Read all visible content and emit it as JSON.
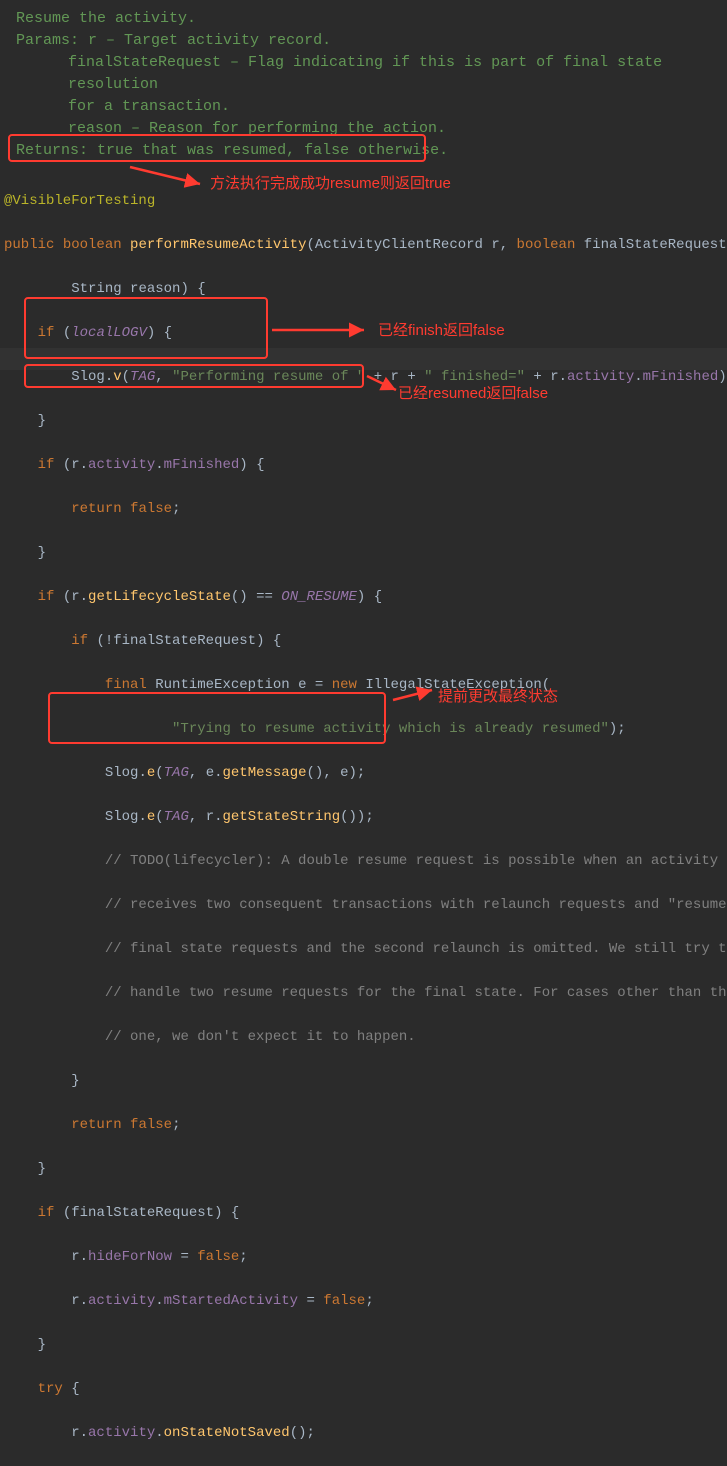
{
  "doc": {
    "l1": "Resume the activity.",
    "params_label": "Params:",
    "p1": "r – Target activity record.",
    "p2": "finalStateRequest – Flag indicating if this is part of final state resolution",
    "p2b": "for a transaction.",
    "p3": "reason – Reason for performing the action.",
    "returns_label": "Returns:",
    "returns_body_a": "true",
    "returns_body_b": " that was resumed, ",
    "returns_body_c": "false",
    "returns_body_d": " otherwise."
  },
  "code": {
    "ann": "@VisibleForTesting",
    "kw_public": "public",
    "kw_boolean": "boolean",
    "m_perform": "performResumeActivity",
    "t_ActivityClientRecord": "ActivityClientRecord",
    "p_r": "r",
    "p_finalStateRequest": "finalStateRequest",
    "t_String": "String",
    "p_reason": "reason",
    "kw_if": "if",
    "f_localLOGV": "localLOGV",
    "c_Slog": "Slog",
    "m_v": "v",
    "c_TAG": "TAG",
    "s_perf1": "\"Performing resume of \"",
    "s_fin": "\" finished=\"",
    "f_activity": "activity",
    "f_mFinished": "mFinished",
    "kw_return": "return",
    "kw_false": "false",
    "m_getLifecycleState": "getLifecycleState",
    "c_ON_RESUME": "ON_RESUME",
    "kw_final": "final",
    "t_RuntimeException": "RuntimeException",
    "v_e": "e",
    "kw_new": "new",
    "t_IllegalStateException": "IllegalStateException",
    "s_trying": "\"Trying to resume activity which is already resumed\"",
    "m_e": "e",
    "m_getMessage": "getMessage",
    "m_getStateString": "getStateString",
    "cm1": "// TODO(lifecycler): A double resume request is possible when an activity",
    "cm2": "// receives two consequent transactions with relaunch requests and \"resumed\"",
    "cm3": "// final state requests and the second relaunch is omitted. We still try to",
    "cm4": "// handle two resume requests for the final state. For cases other than this",
    "cm5": "// one, we don't expect it to happen.",
    "f_hideForNow": "hideForNow",
    "f_mStartedActivity": "mStartedActivity",
    "kw_try": "try",
    "m_onStateNotSaved": "onStateNotSaved"
  },
  "annotations": {
    "a1": "方法执行完成成功resume则返回true",
    "a2": "已经finish返回false",
    "a3": "已经resumed返回false",
    "a4": "提前更改最终状态"
  }
}
